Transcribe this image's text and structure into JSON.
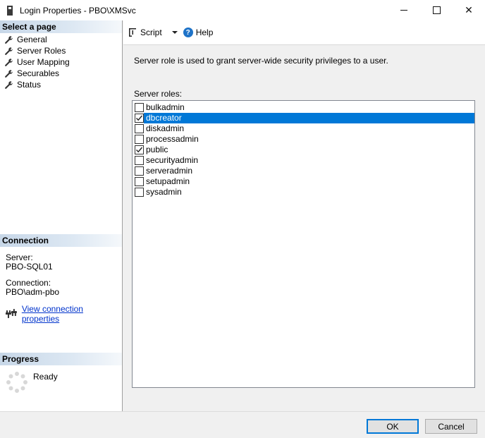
{
  "window": {
    "title": "Login Properties - PBO\\XMSvc",
    "close_glyph": "✕"
  },
  "left": {
    "select_page_header": "Select a page",
    "pages": [
      {
        "label": "General"
      },
      {
        "label": "Server Roles"
      },
      {
        "label": "User Mapping"
      },
      {
        "label": "Securables"
      },
      {
        "label": "Status"
      }
    ],
    "connection": {
      "header": "Connection",
      "server_label": "Server:",
      "server_value": "PBO-SQL01",
      "connection_label": "Connection:",
      "connection_value": "PBO\\adm-pbo",
      "link_text": "View connection properties"
    },
    "progress": {
      "header": "Progress",
      "status": "Ready"
    }
  },
  "toolbar": {
    "script_label": "Script",
    "help_label": "Help",
    "help_glyph": "?"
  },
  "content": {
    "description": "Server role is used to grant server-wide security privileges to a user.",
    "roles_label": "Server roles:",
    "roles": [
      {
        "name": "bulkadmin",
        "checked": false
      },
      {
        "name": "dbcreator",
        "checked": true,
        "selected": true
      },
      {
        "name": "diskadmin",
        "checked": false
      },
      {
        "name": "processadmin",
        "checked": false
      },
      {
        "name": "public",
        "checked": true
      },
      {
        "name": "securityadmin",
        "checked": false
      },
      {
        "name": "serveradmin",
        "checked": false
      },
      {
        "name": "setupadmin",
        "checked": false
      },
      {
        "name": "sysadmin",
        "checked": false
      }
    ]
  },
  "buttons": {
    "ok": "OK",
    "cancel": "Cancel"
  },
  "colors": {
    "selection": "#0078d7",
    "link": "#0033cc",
    "section_header": "#c7d7e8"
  }
}
